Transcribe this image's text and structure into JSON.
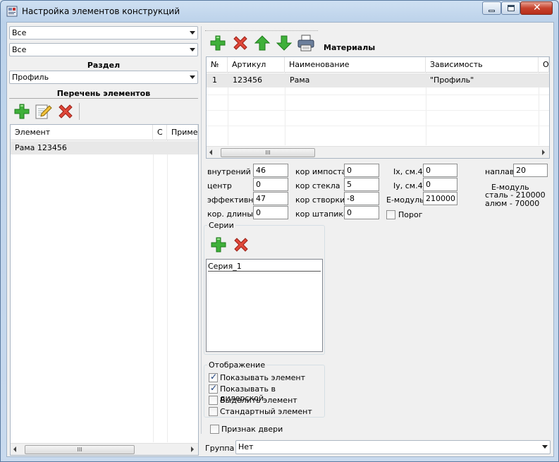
{
  "window": {
    "title": "Настройка элементов конструкций",
    "accent": "#2f9c2f"
  },
  "left": {
    "combo1": "Все",
    "combo2": "Все",
    "section_label": "Раздел",
    "section_value": "Профиль",
    "list_label": "Перечень элементов",
    "grid": {
      "columns": [
        "Элемент",
        "С",
        "Примеча"
      ],
      "rows": [
        [
          "Рама 123456",
          "",
          ""
        ]
      ]
    },
    "scroll_thumb": "III"
  },
  "materials": {
    "label": "Материалы",
    "columns": [
      "№",
      "Артикул",
      "Наименование",
      "Зависимость",
      "Оп"
    ],
    "rows": [
      [
        "1",
        "123456",
        "Рама",
        "\"Профиль\"",
        ""
      ]
    ],
    "scroll_thumb": "III"
  },
  "params": {
    "vnutr_label": "внутрений",
    "vnutr": "46",
    "centr_label": "центр",
    "centr": "0",
    "eff_label": "эффективн",
    "eff": "47",
    "kordl_label": "кор. длины",
    "kordl": "0",
    "korimp_label": "кор импоста",
    "korimp": "0",
    "korstek_label": "кор стекла",
    "korstek": "5",
    "korstv_label": "кор створки",
    "korstv": "-8",
    "korsht_label": "кор штапика",
    "korsht": "0",
    "ix_label": "Ix, см.4",
    "ix": "0",
    "iy_label": "Iy, см.4",
    "iy": "0",
    "emod_label": "Е-модуль",
    "emod": "210000",
    "porog_label": "Порог",
    "naplav_label": "наплав",
    "naplav": "20",
    "emod_note1": "Е-модуль",
    "emod_note2": "сталь - 210000",
    "emod_note3": "алюм - 70000"
  },
  "series": {
    "label": "Серии",
    "items": [
      "Серия_1"
    ]
  },
  "display": {
    "label": "Отображение",
    "options": [
      {
        "label": "Показывать элемент",
        "checked": true
      },
      {
        "label": "Показывать в дилерской",
        "checked": true
      },
      {
        "label": "Выделить элемент",
        "checked": false
      },
      {
        "label": "Стандартный элемент",
        "checked": false
      }
    ]
  },
  "door_label": "Признак двери",
  "group_label": "Группа",
  "group_value": "Нет"
}
